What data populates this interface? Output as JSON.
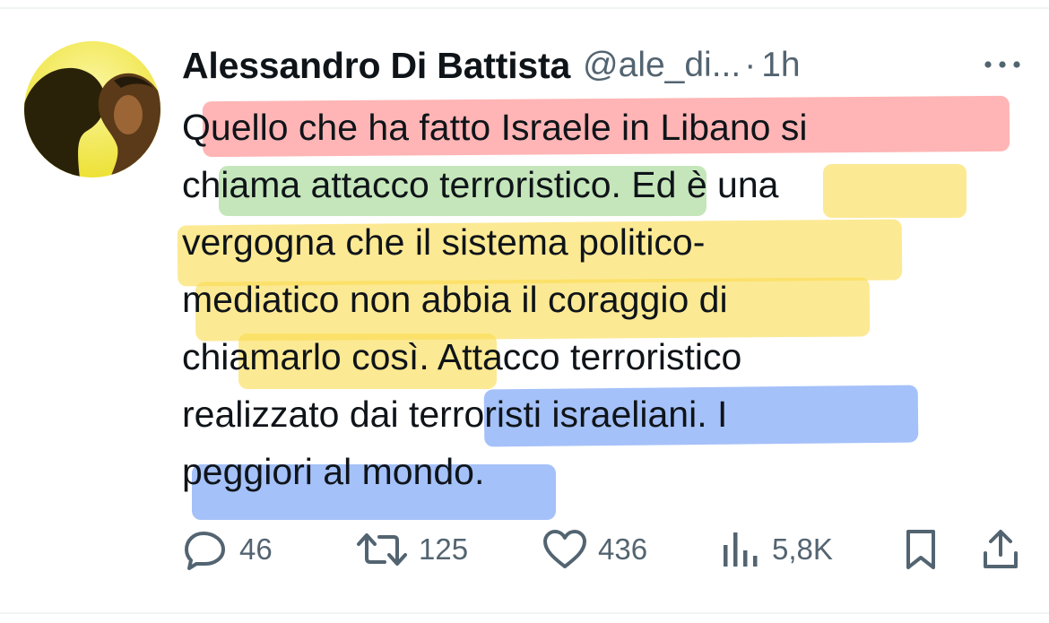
{
  "post": {
    "author_name": "Alessandro Di Battista",
    "author_handle": "@ale_di...",
    "separator": "·",
    "timestamp": "1h",
    "text_lines": [
      "Quello che ha fatto Israele in Libano si",
      "chiama attacco terroristico. Ed è una",
      "vergogna che il sistema politico-",
      "mediatico non abbia il coraggio di",
      "chiamarlo così. Attacco terroristico",
      "realizzato dai terroristi israeliani. I",
      "peggiori al mondo."
    ]
  },
  "actions": {
    "replies": "46",
    "reposts": "125",
    "likes": "436",
    "views": "5,8K"
  },
  "icons": {
    "more": "more-horizontal-icon",
    "reply": "reply-icon",
    "repost": "repost-icon",
    "like": "heart-icon",
    "views": "views-icon",
    "bookmark": "bookmark-icon",
    "share": "share-icon"
  },
  "colors": {
    "text": "#0f1419",
    "secondary_text": "#536471",
    "highlight_red": "#ff7878",
    "highlight_green": "#96d282",
    "highlight_yellow": "#fadc50",
    "highlight_blue": "#6e9bf5"
  }
}
